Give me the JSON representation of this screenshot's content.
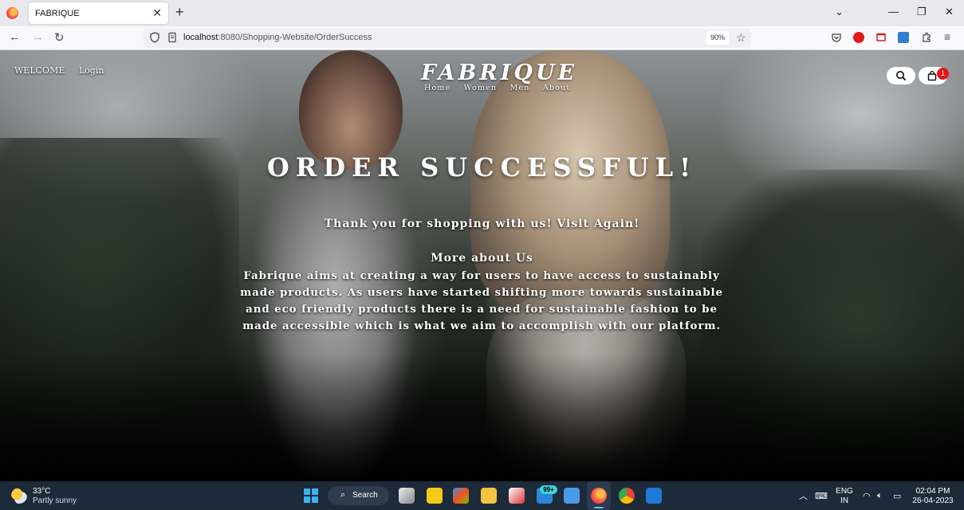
{
  "browser": {
    "tab_title": "FABRIQUE",
    "url_host": "localhost",
    "url_rest": ":8080/Shopping-Website/OrderSuccess",
    "zoom": "90%"
  },
  "site": {
    "nav_left": [
      "WELCOME",
      "Login"
    ],
    "brand": "FABRIQUE",
    "menu": [
      "Home",
      "Women",
      "Men",
      "About"
    ],
    "cart_count": "1"
  },
  "content": {
    "heading": "ORDER SUCCESSFUL!",
    "thanks": "Thank you for shopping with us! Visit Again!",
    "about_title": "More about Us",
    "about_body": "Fabrique aims at creating a way for users to have access to sustainably made products. As users have started shifting more towards sustainable and eco friendly products there is a need for sustainable fashion to be made accessible which is what we aim to accomplish with our platform."
  },
  "taskbar": {
    "weather_temp": "33°C",
    "weather_desc": "Partly sunny",
    "search_label": "Search",
    "notification_badge": "99+",
    "language": "ENG",
    "region": "IN",
    "time": "02:04 PM",
    "date": "26-04-2023"
  }
}
